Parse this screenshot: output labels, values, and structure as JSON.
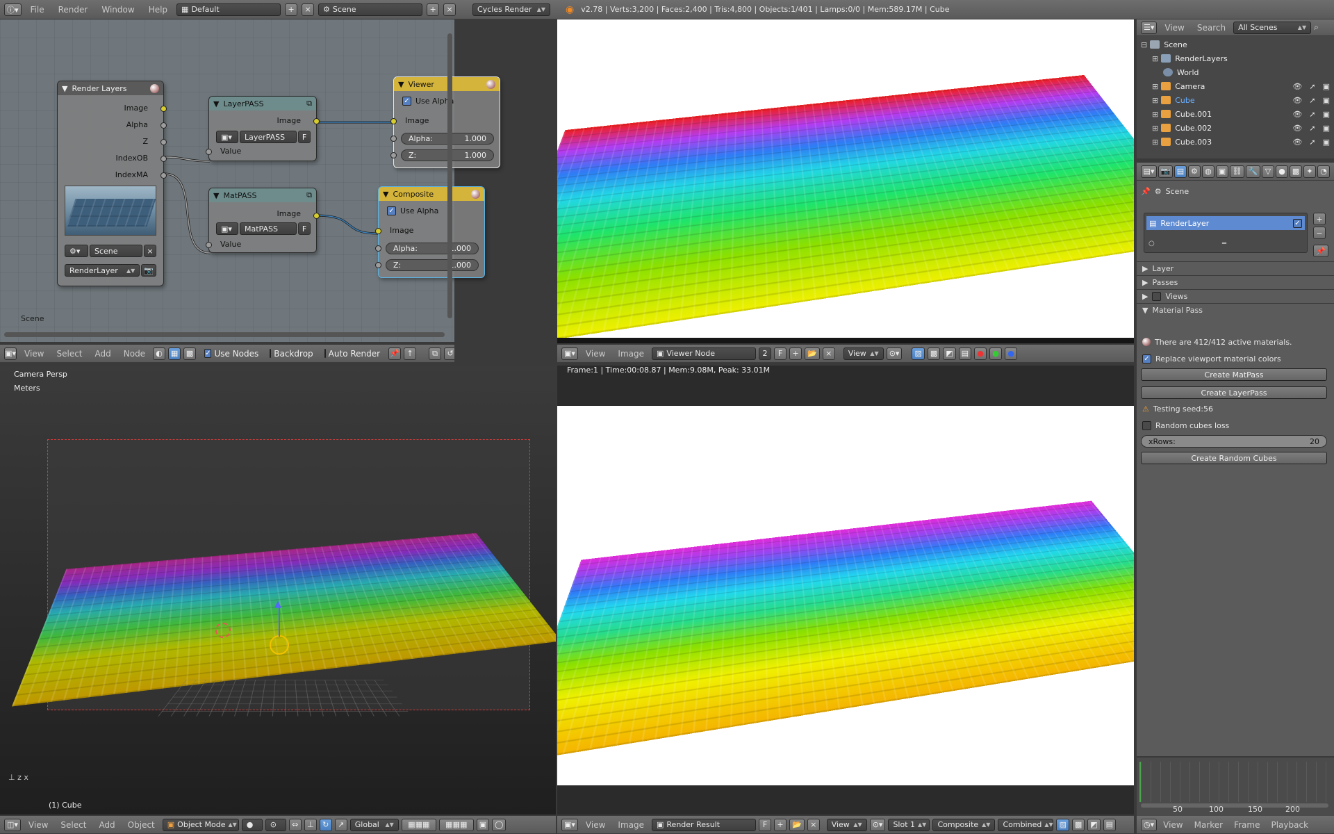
{
  "top_header": {
    "menus": [
      "File",
      "Render",
      "Window",
      "Help"
    ],
    "layout": "Default",
    "scene": "Scene",
    "engine": "Cycles Render",
    "stats": "v2.78 | Verts:3,200 | Faces:2,400 | Tris:4,800 | Objects:1/401 | Lamps:0/0 | Mem:589.17M | Cube"
  },
  "node_editor": {
    "context_label": "Scene",
    "nodes": {
      "render_layers": {
        "title": "Render Layers",
        "outputs": [
          "Image",
          "Alpha",
          "Z",
          "IndexOB",
          "IndexMA"
        ],
        "scene": "Scene",
        "layer": "RenderLayer"
      },
      "layerpass": {
        "title": "LayerPASS",
        "output": "Image",
        "group": "LayerPASS",
        "fake": "F",
        "input": "Value"
      },
      "matpass": {
        "title": "MatPASS",
        "output": "Image",
        "group": "MatPASS",
        "fake": "F",
        "input": "Value"
      },
      "viewer": {
        "title": "Viewer",
        "use_alpha": "Use Alpha",
        "input": "Image",
        "alpha_label": "Alpha:",
        "alpha_value": "1.000",
        "z_label": "Z:",
        "z_value": "1.000"
      },
      "composite": {
        "title": "Composite",
        "use_alpha": "Use Alpha",
        "input": "Image",
        "alpha_label": "Alpha:",
        "alpha_value": "1.000",
        "z_label": "Z:",
        "z_value": "1.000"
      }
    },
    "header": {
      "menus": [
        "View",
        "Select",
        "Add",
        "Node"
      ],
      "use_nodes": "Use Nodes",
      "backdrop": "Backdrop",
      "auto_render": "Auto Render"
    }
  },
  "image_top": {
    "header": {
      "menus": [
        "View",
        "Image"
      ],
      "image": "Viewer Node",
      "users": "2",
      "fake": "F",
      "view": "View"
    }
  },
  "viewport": {
    "persp": "Camera Persp",
    "units": "Meters",
    "object": "(1) Cube",
    "header": {
      "menus": [
        "View",
        "Select",
        "Add",
        "Object"
      ],
      "mode": "Object Mode",
      "orientation": "Global"
    }
  },
  "image_bottom": {
    "info": "Frame:1 | Time:00:08.87 | Mem:9.08M, Peak: 33.01M",
    "header": {
      "menus": [
        "View",
        "Image"
      ],
      "image": "Render Result",
      "fake": "F",
      "view": "View",
      "slot": "Slot 1",
      "layer": "Composite",
      "pass": "Combined"
    }
  },
  "outliner": {
    "header": {
      "menus": [
        "View",
        "Search"
      ],
      "filter": "All Scenes"
    },
    "items": [
      {
        "label": "Scene",
        "indent": 0
      },
      {
        "label": "RenderLayers",
        "indent": 1
      },
      {
        "label": "World",
        "indent": 1
      },
      {
        "label": "Camera",
        "indent": 1
      },
      {
        "label": "Cube",
        "indent": 1,
        "selected": true
      },
      {
        "label": "Cube.001",
        "indent": 1
      },
      {
        "label": "Cube.002",
        "indent": 1
      },
      {
        "label": "Cube.003",
        "indent": 1
      }
    ]
  },
  "properties": {
    "breadcrumb": "Scene",
    "layer_item": "RenderLayer",
    "sections": [
      "Layer",
      "Passes",
      "Views"
    ],
    "panel_title": "Material Pass",
    "active_info": "There are 412/412 active materials.",
    "replace_label": "Replace viewport material colors",
    "create_matpass": "Create MatPass",
    "create_layerpass": "Create LayerPass",
    "testing_seed": "Testing seed:56",
    "random_loss": "Random cubes loss",
    "xrows_label": "xRows:",
    "xrows_value": "20",
    "create_random": "Create Random Cubes"
  },
  "timeline": {
    "ticks": [
      "50",
      "100",
      "150",
      "200"
    ],
    "menus": [
      "View",
      "Marker",
      "Frame",
      "Playback"
    ]
  },
  "colors": {
    "accent": "#5680c2",
    "socket_yellow": "#d6cc2e",
    "viewer_header": "#d4b43a",
    "selected_row": "#5d8ad0"
  }
}
